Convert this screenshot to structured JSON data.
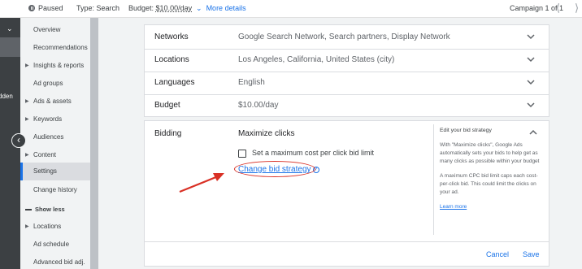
{
  "topbar": {
    "status": "Paused",
    "type": "Type: Search",
    "budget_label": "Budget:",
    "budget_value": "$10.00/day",
    "more_details": "More details",
    "pager": "Campaign 1 of 1"
  },
  "leftstrip": {
    "fragment": "dden"
  },
  "nav": {
    "items": [
      {
        "label": "Overview"
      },
      {
        "label": "Recommendations"
      },
      {
        "label": "Insights & reports"
      },
      {
        "label": "Ad groups"
      },
      {
        "label": "Ads & assets"
      },
      {
        "label": "Keywords"
      },
      {
        "label": "Audiences"
      },
      {
        "label": "Content"
      },
      {
        "label": "Settings"
      },
      {
        "label": "Change history"
      },
      {
        "label": "Show less"
      },
      {
        "label": "Locations"
      },
      {
        "label": "Ad schedule"
      },
      {
        "label": "Advanced bid adj."
      }
    ]
  },
  "settings": {
    "rows": [
      {
        "label": "Networks",
        "value": "Google Search Network, Search partners, Display Network"
      },
      {
        "label": "Locations",
        "value": "Los Angeles, California, United States (city)"
      },
      {
        "label": "Languages",
        "value": "English"
      },
      {
        "label": "Budget",
        "value": "$10.00/day"
      }
    ],
    "bidding": {
      "label": "Bidding",
      "strategy": "Maximize clicks",
      "checkbox_label": "Set a maximum cost per click bid limit",
      "change_link": "Change bid strategy",
      "help_title": "Edit your bid strategy",
      "help_p1": "With \"Maximize clicks\", Google Ads automatically sets your bids to help get as many clicks as possible within your budget",
      "help_p2": "A maximum CPC bid limit caps each cost-per-click bid. This could limit the clicks on your ad.",
      "learn_more": "Learn more",
      "cancel": "Cancel",
      "save": "Save"
    }
  },
  "colors": {
    "accent": "#1a73e8",
    "annotation": "#d93025",
    "sidebar_dark": "#3c4043"
  }
}
